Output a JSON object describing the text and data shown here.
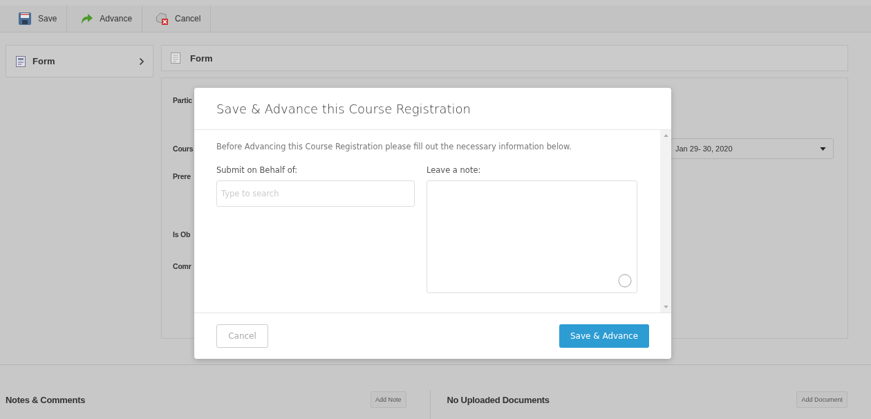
{
  "toolbar": [
    {
      "label": "Save",
      "kind": "save"
    },
    {
      "label": "Advance",
      "kind": "advance"
    },
    {
      "label": "Cancel",
      "kind": "cancel"
    }
  ],
  "sidebar": {
    "items": [
      {
        "label": "Form",
        "expanded": false
      }
    ]
  },
  "form_panel": {
    "title": "Form",
    "fields": [
      {
        "label": "Partic"
      },
      {
        "label": "Cours",
        "value": "Jan 29- 30, 2020"
      },
      {
        "label": "Prere"
      },
      {
        "label": "Is Ob"
      },
      {
        "label": "Comr"
      }
    ]
  },
  "dialog": {
    "title": "Save & Advance this Course Registration",
    "description": "Before Advancing this Course Registration please fill out the necessary information below.",
    "submit_on_behalf": {
      "label": "Submit on Behalf of:",
      "placeholder": "Type to search"
    },
    "note": {
      "label": "Leave a note:"
    },
    "buttons": [
      {
        "label": "Cancel",
        "kind": "secondary"
      },
      {
        "label": "Save & Advance",
        "kind": "primary"
      }
    ]
  },
  "notes": {
    "title": "Notes & Comments",
    "button": "Add Note"
  },
  "documents": {
    "title": "No Uploaded Documents",
    "button": "Add Document"
  }
}
